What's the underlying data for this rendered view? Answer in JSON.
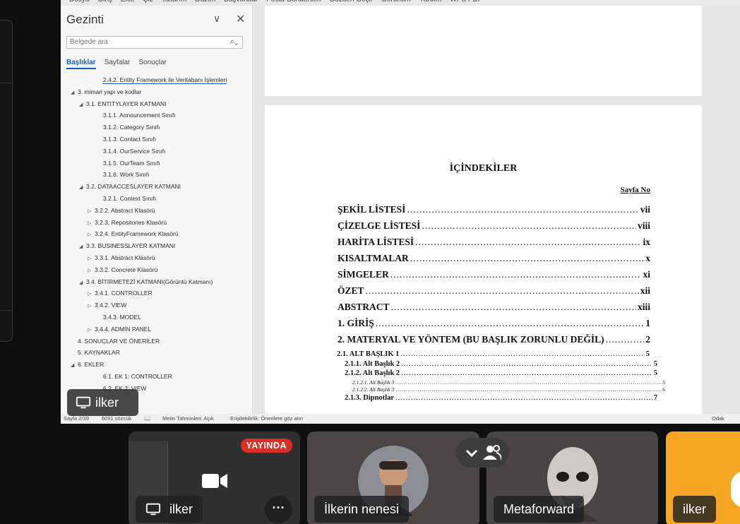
{
  "menubar": [
    "Dosya",
    "Giriş",
    "Ekle",
    "Çiz",
    "Tasarım",
    "Düzen",
    "Başvurular",
    "Posta Gönderileri",
    "Gözden Geçir",
    "Görünüm",
    "Yardım",
    "WPS PDF"
  ],
  "navigation": {
    "title": "Gezinti",
    "search_placeholder": "Belgede ara",
    "tabs": [
      {
        "label": "Başlıklar",
        "active": true
      },
      {
        "label": "Sayfalar",
        "active": false
      },
      {
        "label": "Sonuçlar",
        "active": false
      }
    ],
    "items": [
      {
        "text": "2.4.2. Entity Framework ile Veritabanı İşlemleri",
        "level": 3,
        "arrow": ""
      },
      {
        "text": "3. mimari yapı ve kodlar",
        "level": 0,
        "arrow": "◢"
      },
      {
        "text": "3.1. ENTITYLAYER KATMANI",
        "level": 1,
        "arrow": "◢"
      },
      {
        "text": "3.1.1. Announcement Sınıfı",
        "level": 3,
        "arrow": ""
      },
      {
        "text": "3.1.2. Category Sınıfı",
        "level": 3,
        "arrow": ""
      },
      {
        "text": "3.1.3. Contact Sınıfı",
        "level": 3,
        "arrow": ""
      },
      {
        "text": "3.1.4. OurService Sınıfı",
        "level": 3,
        "arrow": ""
      },
      {
        "text": "3.1.5. OurTeam Sınıfı",
        "level": 3,
        "arrow": ""
      },
      {
        "text": "3.1.6. Work Sınıfı",
        "level": 3,
        "arrow": ""
      },
      {
        "text": "3.2. DATAACCESLAYER KATMANI",
        "level": 1,
        "arrow": "◢"
      },
      {
        "text": "3.2.1. Context Sınıfı",
        "level": 3,
        "arrow": ""
      },
      {
        "text": "3.2.2. Abstract Klasörü",
        "level": 2,
        "arrow": "▷"
      },
      {
        "text": "3.2.3. Repositories Klasörü",
        "level": 2,
        "arrow": "▷"
      },
      {
        "text": "3.2.4. EntityFramework Klasörü",
        "level": 2,
        "arrow": "▷"
      },
      {
        "text": "3.3. BUSINESSLAYER KATMANI",
        "level": 1,
        "arrow": "◢"
      },
      {
        "text": "3.3.1. Abstract Klasörü",
        "level": 2,
        "arrow": "▷"
      },
      {
        "text": "3.3.2. Concrete Klasörü",
        "level": 2,
        "arrow": "▷"
      },
      {
        "text": "3.4. BİTİRMETEZİ KATMANI(Görüntü Katmanı)",
        "level": 1,
        "arrow": "◢"
      },
      {
        "text": "3.4.1. CONTROLLER",
        "level": 2,
        "arrow": "▷"
      },
      {
        "text": "3.4.2. VIEW",
        "level": 2,
        "arrow": "▷"
      },
      {
        "text": "3.4.3. MODEL",
        "level": 3,
        "arrow": ""
      },
      {
        "text": "3.4.4. ADMİN PANEL",
        "level": 2,
        "arrow": "▷"
      },
      {
        "text": "4. SONUÇLAR VE ÖNERİLER",
        "level": 0,
        "arrow": ""
      },
      {
        "text": "5. KAYNAKLAR",
        "level": 0,
        "arrow": ""
      },
      {
        "text": "6. EKLER",
        "level": 0,
        "arrow": "◢"
      },
      {
        "text": "6.1. EK 1: CONTROLLER",
        "level": 3,
        "arrow": ""
      },
      {
        "text": "6.2. EK 2: VIEW",
        "level": 3,
        "arrow": ""
      }
    ]
  },
  "document": {
    "toc_heading": "İÇİNDEKİLER",
    "page_no_label": "Sayfa No",
    "entries": [
      {
        "title": "ŞEKİL LİSTESİ",
        "page": "vii",
        "size": "big"
      },
      {
        "title": "ÇİZELGE LİSTESİ",
        "page": "viii",
        "size": "big"
      },
      {
        "title": "HARİTA LİSTESİ",
        "page": "ix",
        "size": "big"
      },
      {
        "title": "KISALTMALAR",
        "page": "x",
        "size": "big"
      },
      {
        "title": "SİMGELER",
        "page": "xi",
        "size": "big"
      },
      {
        "title": "ÖZET",
        "page": "xii",
        "size": "big"
      },
      {
        "title": "ABSTRACT",
        "page": "xiii",
        "size": "big"
      },
      {
        "title": "1.    GİRİŞ",
        "page": "1",
        "size": "big"
      },
      {
        "title": "2.    MATERYAL VE YÖNTEM (BU BAŞLIK ZORUNLU DEĞİL)",
        "page": "2",
        "size": "big"
      },
      {
        "title": "2.1. ALT BAŞLIK 1",
        "page": "5",
        "size": "med"
      },
      {
        "title": "2.1.1. Alt Başlık 2",
        "page": "5",
        "size": "med"
      },
      {
        "title": "2.1.2. Alt Başlık 2",
        "page": "5",
        "size": "med"
      },
      {
        "title": "2.1.2.1. Alt Başlık 3",
        "page": "5",
        "size": "small"
      },
      {
        "title": "2.1.2.2. Alt Başlık 3",
        "page": "6",
        "size": "small"
      },
      {
        "title": "2.1.3. Dipnotlar",
        "page": "7",
        "size": "med"
      }
    ]
  },
  "statusbar": {
    "page": "Sayfa 2/39",
    "words": "6091 sözcük",
    "text_predictions": "Metin Tahminleri: Açık",
    "accessibility": "Erişilebilirlik: Önerilere göz atın",
    "focus": "Odak"
  },
  "presenter": {
    "name": "ilker"
  },
  "tiles": [
    {
      "name": "ilker",
      "badge": "YAYINDA",
      "bg": "#2f2f2f"
    },
    {
      "name": "İlkerin nenesi",
      "bg": "#4b4643"
    },
    {
      "name": "Metaforward",
      "bg": "#4a4542"
    },
    {
      "name": "ilker",
      "bg": "#f5a623"
    }
  ],
  "colors": {
    "live": "#d93025",
    "accent": "#1a5fb4"
  }
}
